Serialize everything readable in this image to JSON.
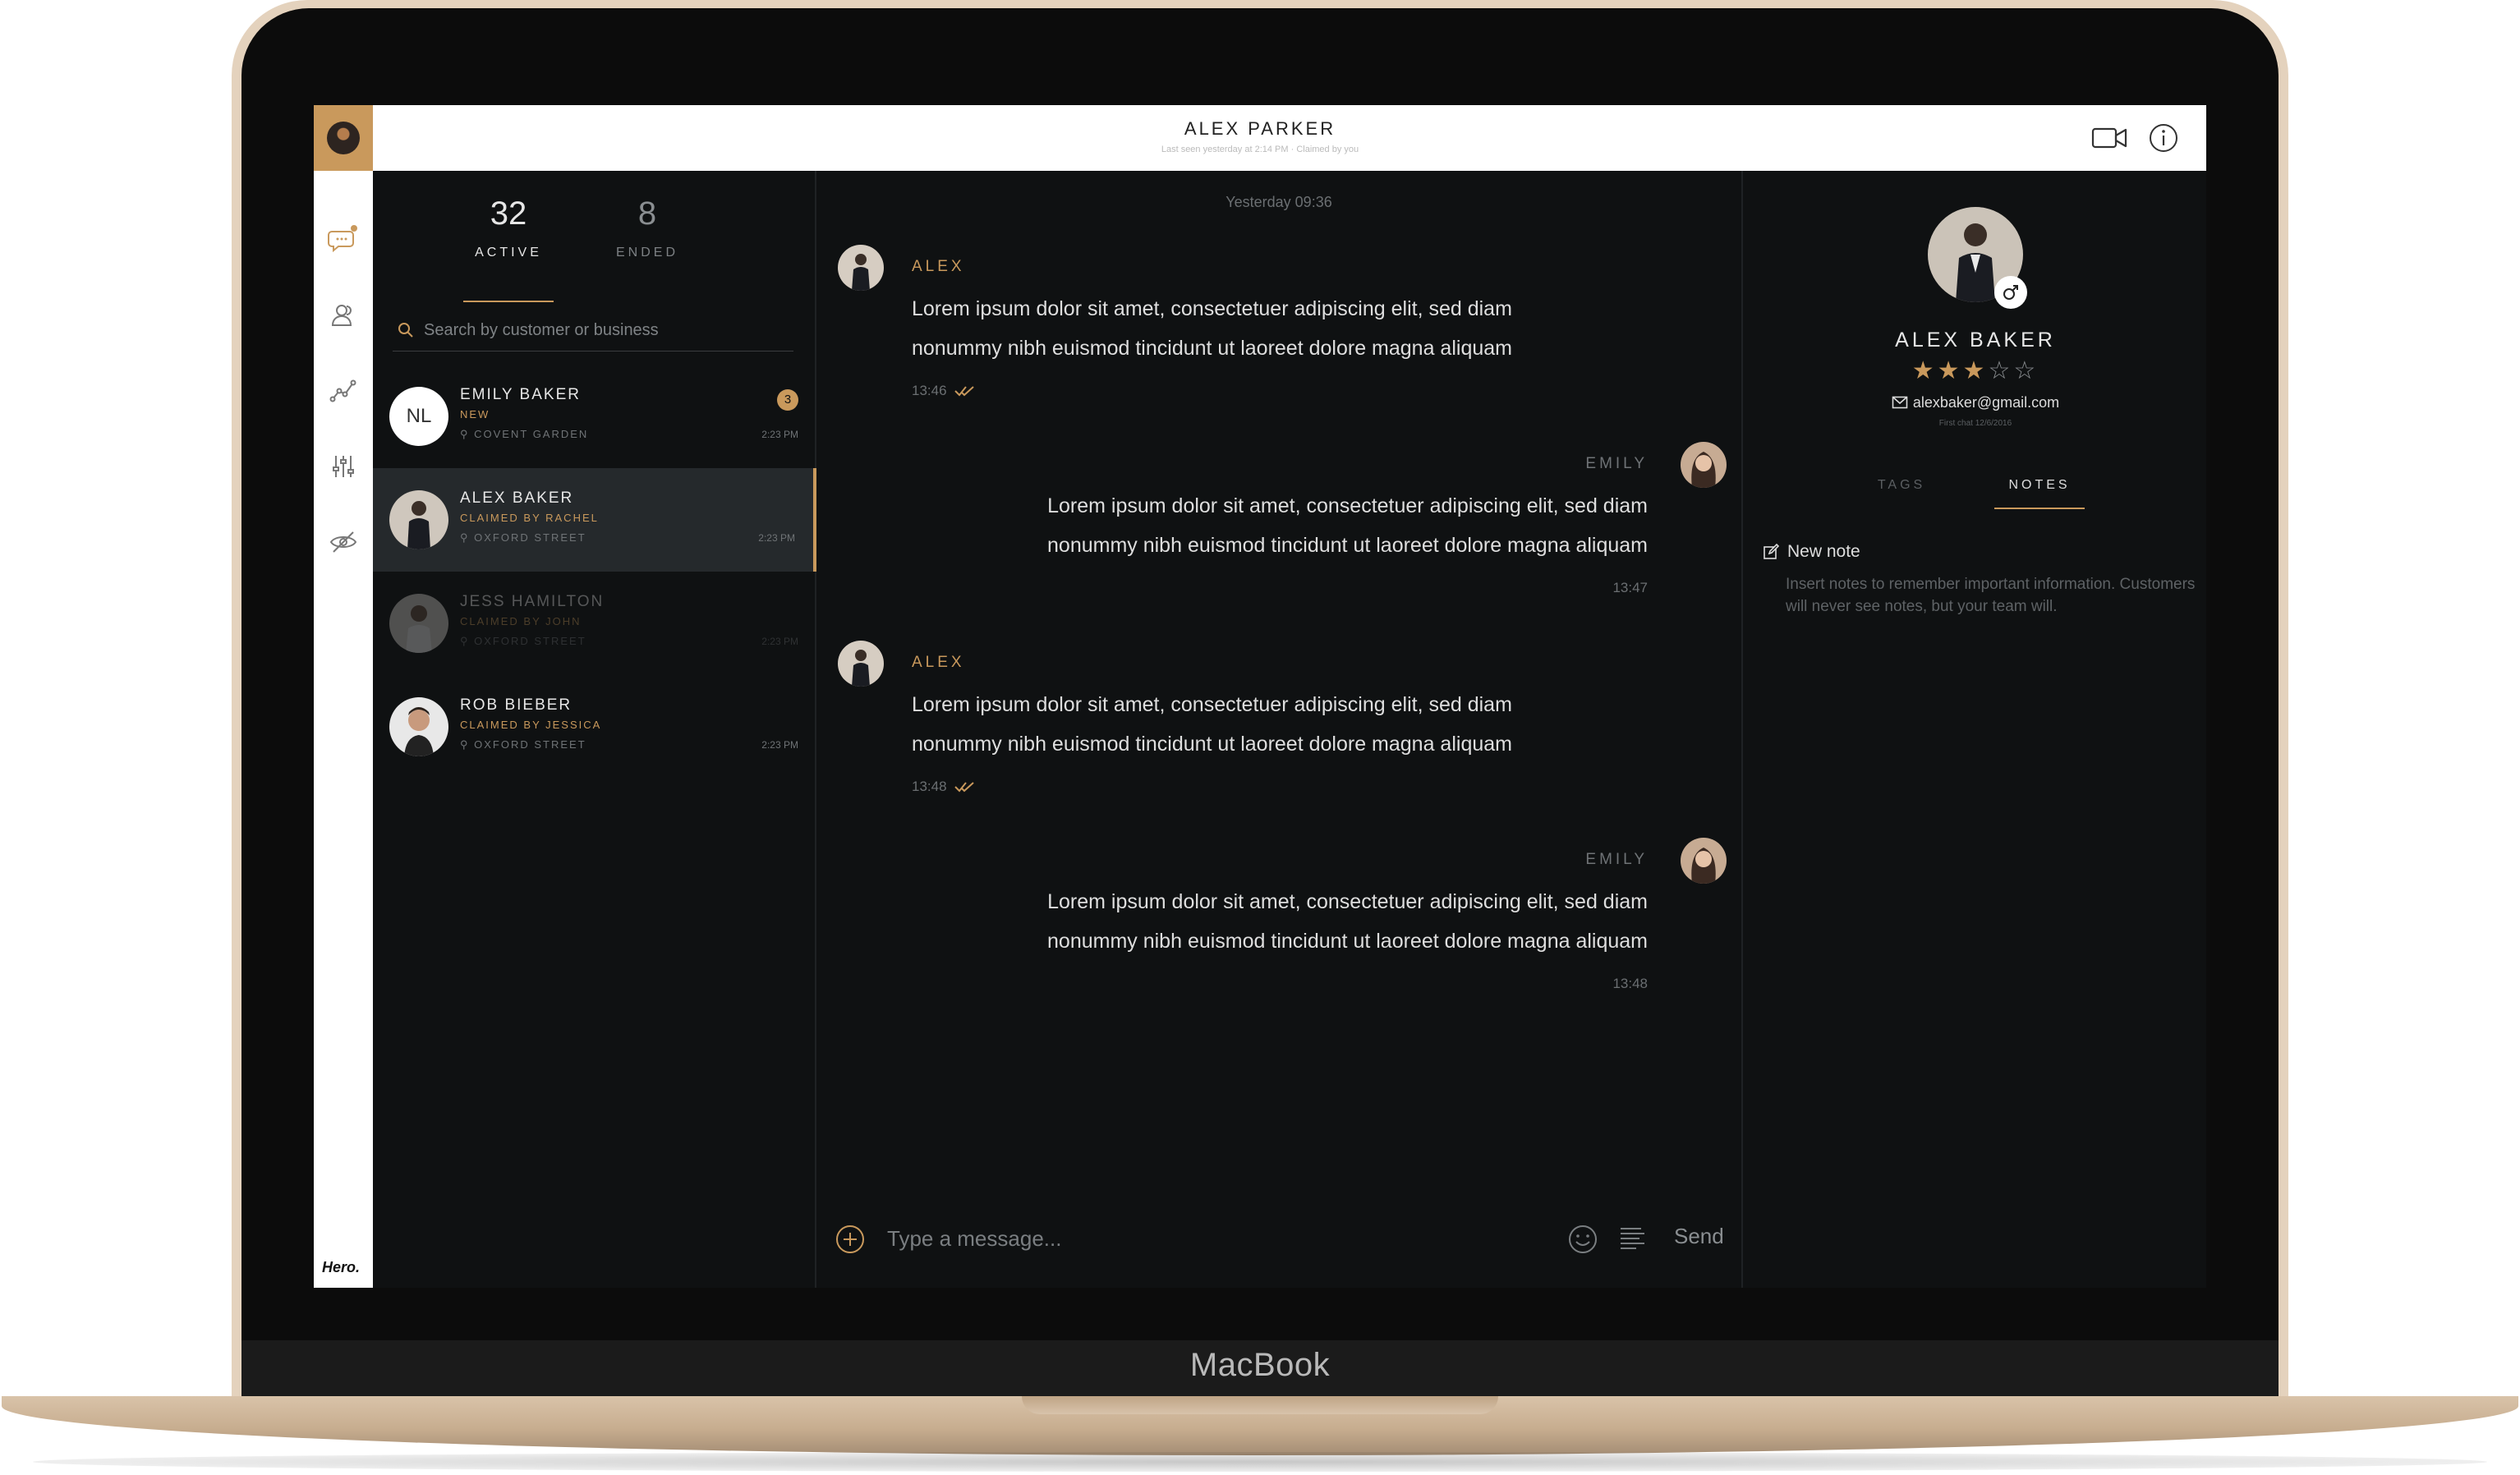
{
  "device": {
    "brand": "MacBook"
  },
  "header": {
    "title": "ALEX PARKER",
    "subtitle": "Last seen yesterday at 2:14 PM · Claimed by you",
    "icons": [
      "video-camera-icon",
      "info-icon"
    ]
  },
  "rail": {
    "icons": [
      "chat-bubble-icon",
      "customers-icon",
      "analytics-icon",
      "settings-sliders-icon",
      "hidden-eye-icon"
    ],
    "logo": "Hero."
  },
  "stats": {
    "active_count": "32",
    "active_label": "ACTIVE",
    "ended_count": "8",
    "ended_label": "ENDED"
  },
  "search": {
    "placeholder": "Search by customer or business"
  },
  "chats": [
    {
      "initials": "NL",
      "name": "EMILY BAKER",
      "status": "NEW",
      "location": "COVENT GARDEN",
      "time": "2:23 PM",
      "badge": "3"
    },
    {
      "name": "ALEX BAKER",
      "status": "CLAIMED BY RACHEL",
      "location": "OXFORD STREET",
      "time": "2:23 PM"
    },
    {
      "name": "JESS HAMILTON",
      "status": "CLAIMED BY JOHN",
      "location": "OXFORD STREET",
      "time": "2:23 PM"
    },
    {
      "name": "ROB BIEBER",
      "status": "CLAIMED BY JESSICA",
      "location": "OXFORD STREET",
      "time": "2:23 PM"
    }
  ],
  "conversation": {
    "date_separator": "Yesterday 09:36",
    "messages": [
      {
        "author": "ALEX",
        "text": "Lorem ipsum dolor sit amet, consectetuer adipiscing elit, sed diam nonummy nibh euismod tincidunt ut laoreet dolore magna aliquam",
        "time": "13:46"
      },
      {
        "author": "EMILY",
        "text": "Lorem ipsum dolor sit amet, consectetuer adipiscing elit, sed diam nonummy nibh euismod tincidunt ut laoreet dolore magna aliquam",
        "time": "13:47"
      },
      {
        "author": "ALEX",
        "text": "Lorem ipsum dolor sit amet, consectetuer adipiscing elit, sed diam nonummy nibh euismod tincidunt ut laoreet dolore magna aliquam",
        "time": "13:48"
      },
      {
        "author": "EMILY",
        "text": "Lorem ipsum dolor sit amet, consectetuer adipiscing elit, sed diam nonummy nibh euismod tincidunt ut laoreet dolore magna aliquam",
        "time": "13:48"
      }
    ],
    "composer": {
      "placeholder": "Type a message...",
      "send_label": "Send"
    }
  },
  "customer": {
    "name": "ALEX BAKER",
    "rating": 3,
    "rating_max": 5,
    "stars_filled": "★★★",
    "stars_empty": "☆☆",
    "email": "alexbaker@gmail.com",
    "first_chat": "First chat 12/6/2016",
    "tabs": [
      "TAGS",
      "NOTES"
    ],
    "active_tab": "NOTES",
    "new_note_label": "New note",
    "note_help": "Insert notes to remember important information. Customers will never see notes, but your team will."
  },
  "colors": {
    "accent": "#c9995c",
    "background": "#0f1112",
    "panel_selected": "#25292c",
    "text_muted": "#6f7376"
  }
}
